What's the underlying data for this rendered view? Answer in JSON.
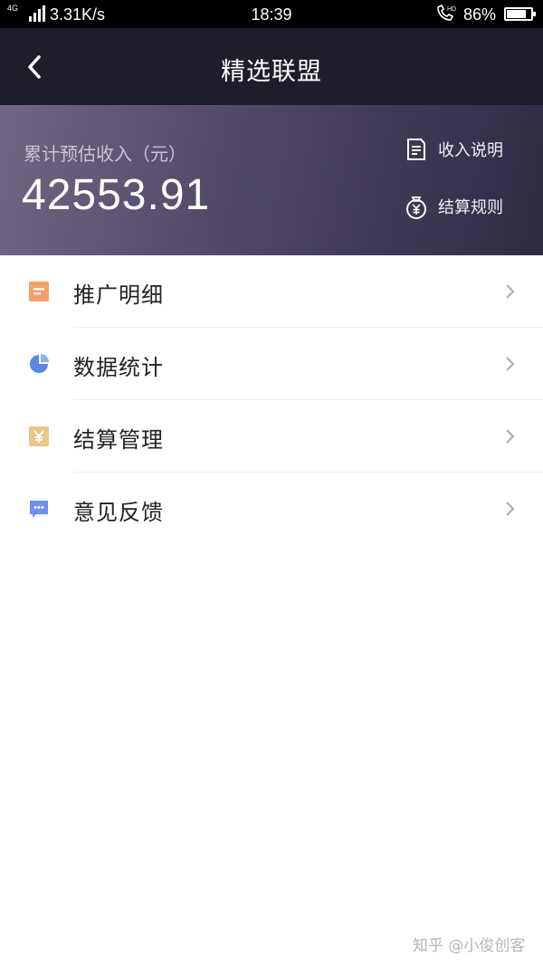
{
  "status_bar": {
    "network": "4G",
    "speed": "3.31K/s",
    "time": "18:39",
    "battery": "86%",
    "battery_level": 0.86
  },
  "nav": {
    "title": "精选联盟",
    "back_icon": "chevron-left-icon"
  },
  "banner": {
    "income_label": "累计预估收入（元）",
    "income_amount": "42553.91",
    "links": [
      {
        "label": "收入说明",
        "icon": "document-icon"
      },
      {
        "label": "结算规则",
        "icon": "yuan-bag-icon"
      }
    ],
    "colors": {
      "gradient_start": "#6e6682",
      "gradient_end": "#2f2a44"
    }
  },
  "menu": {
    "items": [
      {
        "label": "推广明细",
        "icon": "list-icon",
        "color": "#f5a066"
      },
      {
        "label": "数据统计",
        "icon": "pie-chart-icon",
        "color": "#5b86e5"
      },
      {
        "label": "结算管理",
        "icon": "yuan-icon",
        "color": "#e8c78a"
      },
      {
        "label": "意见反馈",
        "icon": "message-icon",
        "color": "#6f8ef0"
      }
    ]
  },
  "watermark": "知乎 @小俊创客"
}
